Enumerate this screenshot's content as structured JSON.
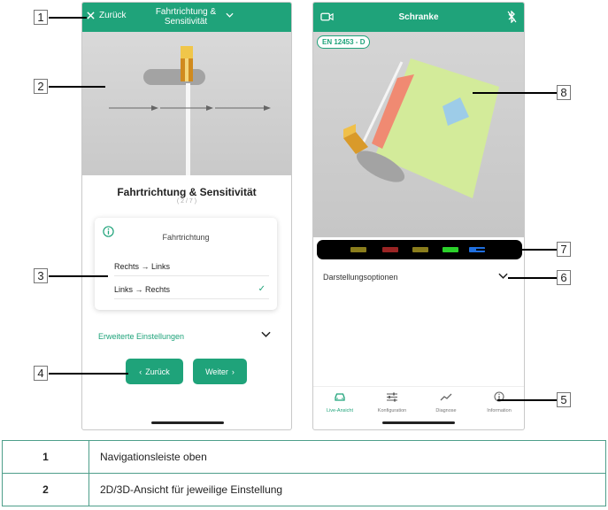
{
  "left_phone": {
    "back_label": "Zurück",
    "title_line1": "Fahrtrichtung &",
    "title_line2": "Sensitivität",
    "card_title": "Fahrtrichtung & Sensitivität",
    "step": "( 2 / 7 )",
    "section_heading": "Fahrtrichtung",
    "options": [
      {
        "label": "Rechts → Links",
        "selected": false
      },
      {
        "label": "Links → Rechts",
        "selected": true
      }
    ],
    "check_mark": "✓",
    "advanced_label": "Erweiterte Einstellungen",
    "back_button": "Zurück",
    "next_button": "Weiter"
  },
  "right_phone": {
    "title": "Schranke",
    "badge": "EN 12453 - D",
    "display_options_label": "Darstellungsoptionen",
    "led_colors": [
      "#8a7d1c",
      "#9a2424",
      "#8a7d1c",
      "#2bd12b",
      "#1f6fe0"
    ],
    "tabs": [
      {
        "label": "Live-Ansicht",
        "icon": "car-icon",
        "active": true
      },
      {
        "label": "Konfiguration",
        "icon": "sliders-icon",
        "active": false
      },
      {
        "label": "Diagnose",
        "icon": "trend-icon",
        "active": false
      },
      {
        "label": "Information",
        "icon": "info-icon",
        "active": false
      }
    ]
  },
  "callouts": [
    "1",
    "2",
    "3",
    "4",
    "5",
    "6",
    "7",
    "8"
  ],
  "legend": [
    {
      "num": "1",
      "text": "Navigationsleiste oben"
    },
    {
      "num": "2",
      "text": "2D/3D-Ansicht für jeweilige Einstellung"
    }
  ],
  "colors": {
    "accent": "#1fa37a"
  }
}
